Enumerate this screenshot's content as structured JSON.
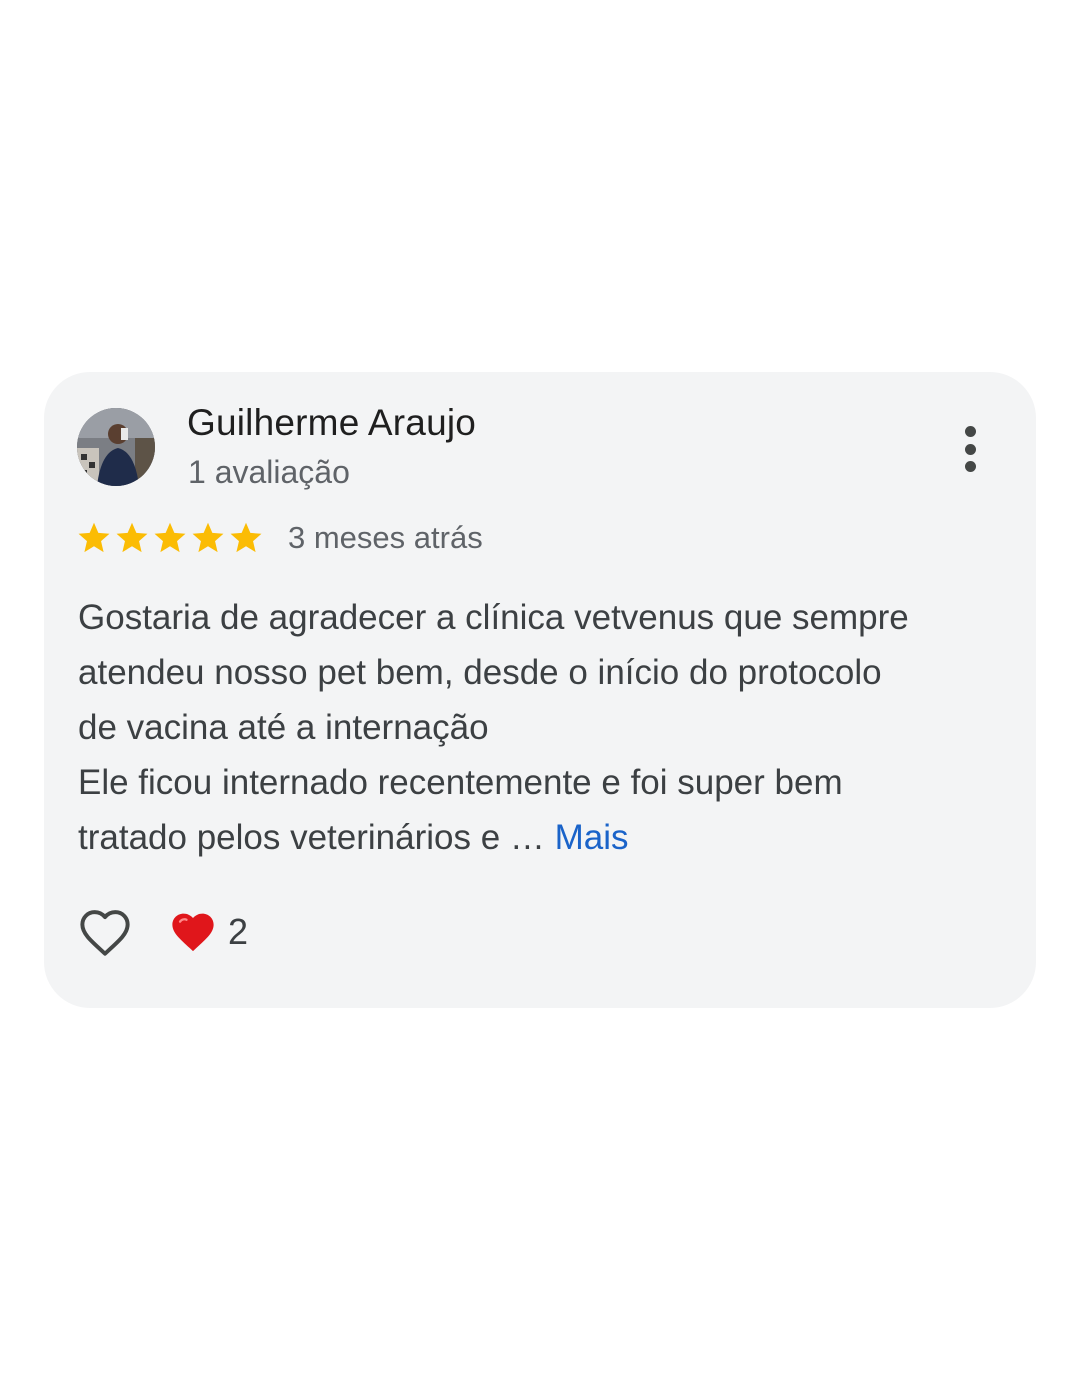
{
  "review": {
    "reviewer_name": "Guilherme Araujo",
    "review_count": "1 avaliação",
    "rating": 5,
    "rating_max": 5,
    "date": "3 meses atrás",
    "text_lines": [
      "Gostaria de agradecer a clínica vetvenus que sempre",
      "atendeu nosso pet bem, desde o início do protocolo",
      "de vacina até a internação",
      "Ele ficou internado recentemente e foi super bem",
      "tratado pelos veterinários e … "
    ],
    "more_label": "Mais",
    "reaction_count": "2"
  },
  "icons": {
    "menu": "more-vert-icon",
    "star": "star-icon",
    "like": "heart-outline-icon",
    "reaction": "red-heart-icon"
  },
  "colors": {
    "card_bg": "#f3f4f5",
    "star": "#fbbc04",
    "link": "#1a63c9",
    "heart": "#e0161b"
  }
}
